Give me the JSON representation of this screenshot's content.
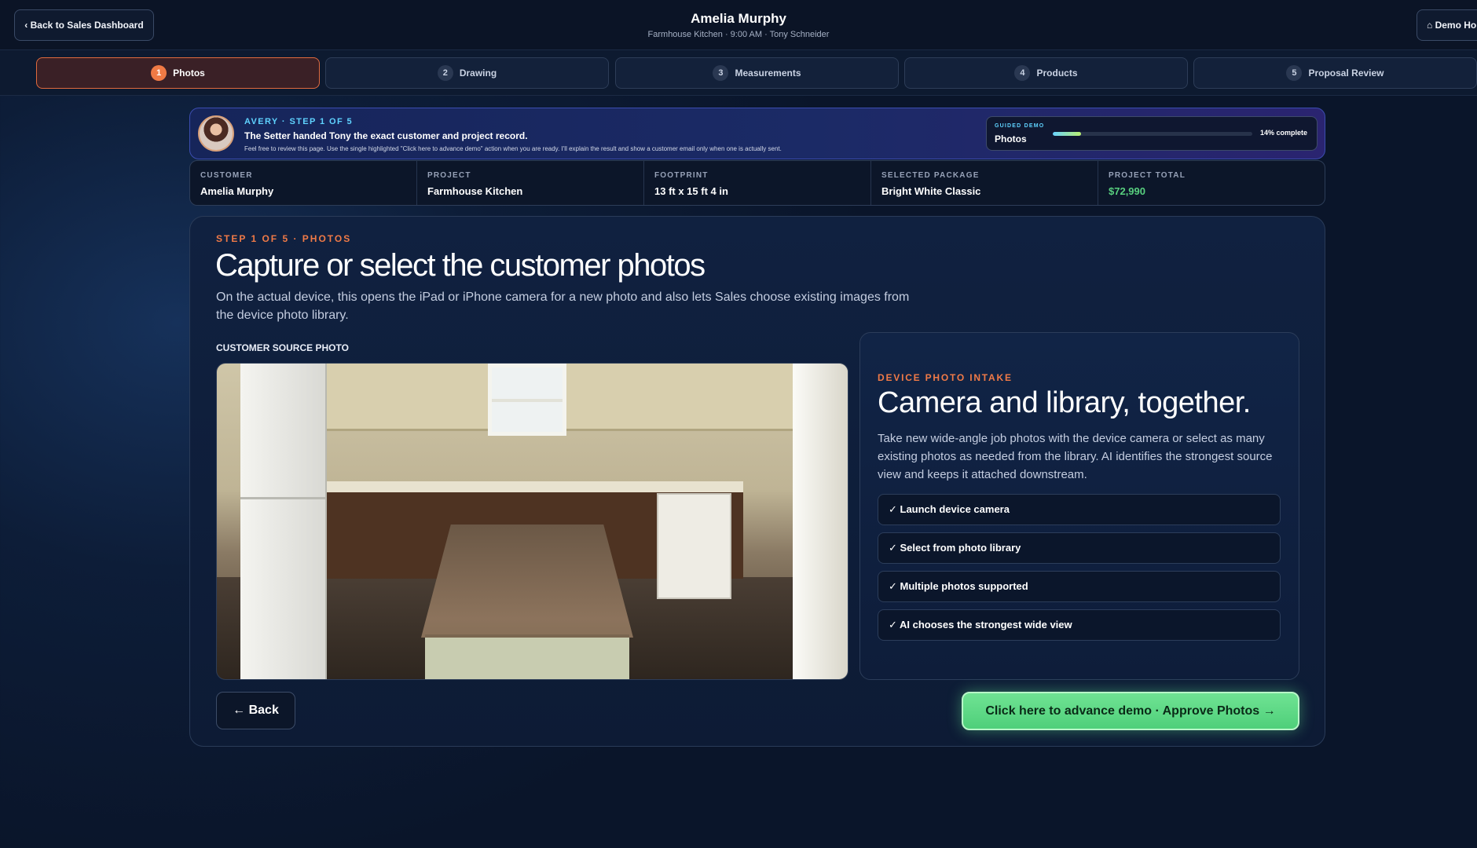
{
  "header": {
    "back_label": "‹ Back to Sales Dashboard",
    "customer_name": "Amelia Murphy",
    "subtitle": "Farmhouse Kitchen · 9:00 AM · Tony Schneider",
    "demo_home_label": "⌂ Demo Home"
  },
  "tabs": [
    {
      "num": "1",
      "label": "Photos",
      "active": true
    },
    {
      "num": "2",
      "label": "Drawing",
      "active": false
    },
    {
      "num": "3",
      "label": "Measurements",
      "active": false
    },
    {
      "num": "4",
      "label": "Products",
      "active": false
    },
    {
      "num": "5",
      "label": "Proposal Review",
      "active": false
    }
  ],
  "banner": {
    "kicker": "AVERY · STEP 1 OF 5",
    "title": "The Setter handed Tony the exact customer and project record.",
    "note": "Feel free to review this page. Use the single highlighted \"Click here to advance demo\" action when you are ready. I'll explain the result and show a customer email only when one is actually sent.",
    "progress_label": "GUIDED DEMO",
    "progress_step": "Photos",
    "progress_fraction": 0.14,
    "progress_text": "14% complete"
  },
  "info": [
    {
      "label": "CUSTOMER",
      "value": "Amelia Murphy"
    },
    {
      "label": "PROJECT",
      "value": "Farmhouse Kitchen"
    },
    {
      "label": "FOOTPRINT",
      "value": "13 ft x 15 ft 4 in"
    },
    {
      "label": "SELECTED PACKAGE",
      "value": "Bright White Classic"
    },
    {
      "label": "PROJECT TOTAL",
      "value": "$72,990"
    }
  ],
  "main": {
    "kicker": "STEP 1 OF 5 · PHOTOS",
    "title": "Capture or select the customer photos",
    "description": "On the actual device, this opens the iPad or iPhone camera for a new photo and also lets Sales choose existing images from the device photo library.",
    "source_label": "CUSTOMER SOURCE PHOTO"
  },
  "device": {
    "kicker": "DEVICE PHOTO INTAKE",
    "title": "Camera and library, together.",
    "description": "Take new wide-angle job photos with the device camera or select as many existing photos as needed from the library. AI identifies the strongest source view and keeps it attached downstream.",
    "features": [
      "✓ Launch device camera",
      "✓ Select from photo library",
      "✓ Multiple photos supported",
      "✓ AI chooses the strongest wide view"
    ]
  },
  "actions": {
    "back_label": "← Back",
    "advance_label": "Click here to advance demo · Approve Photos →"
  },
  "colors": {
    "accent_orange": "#f07a47",
    "accent_cyan": "#5fd3ff",
    "success_green": "#58d07f"
  }
}
